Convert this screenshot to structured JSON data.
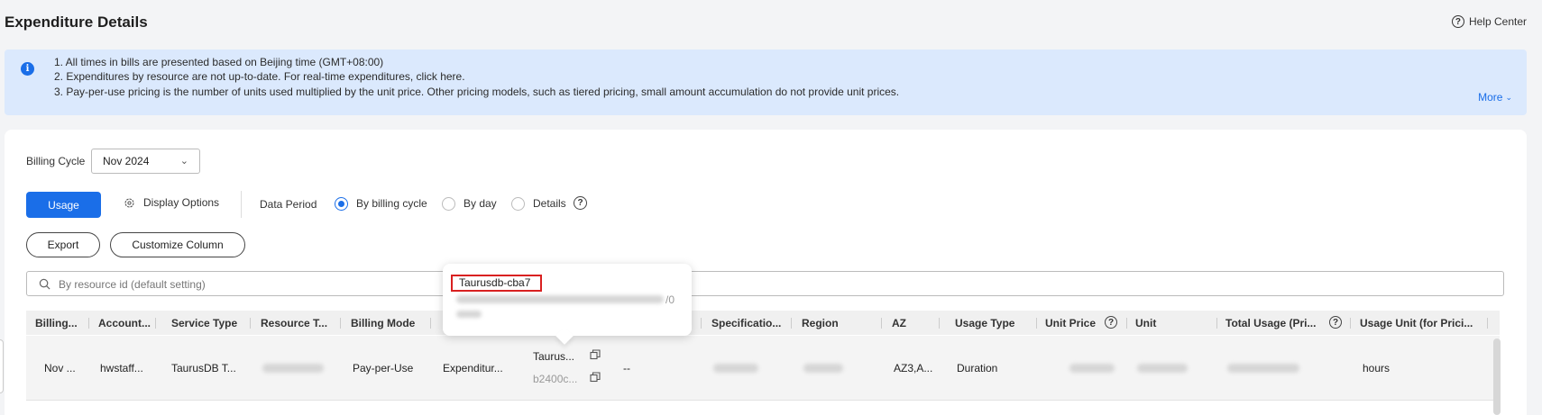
{
  "header": {
    "title": "Expenditure Details",
    "help_label": "Help Center"
  },
  "notice": {
    "lines": [
      "1. All times in bills are presented based on Beijing time (GMT+08:00)",
      "2. Expenditures by resource are not up-to-date. For real-time expenditures, click here.",
      "3. Pay-per-use pricing is the number of units used multiplied by the unit price. Other pricing models, such as tiered pricing, small amount accumulation do not provide unit prices."
    ],
    "more_label": "More"
  },
  "filters": {
    "billing_cycle_label": "Billing Cycle",
    "billing_cycle_value": "Nov 2024",
    "usage_label": "Usage",
    "display_options_label": "Display Options",
    "data_period_label": "Data Period",
    "period_options": [
      {
        "label": "By billing cycle",
        "checked": true
      },
      {
        "label": "By day",
        "checked": false
      },
      {
        "label": "Details",
        "checked": false
      }
    ]
  },
  "toolbar": {
    "export_label": "Export",
    "customize_label": "Customize Column"
  },
  "search": {
    "placeholder": "By resource id (default setting)"
  },
  "table": {
    "columns": [
      "Billing...",
      "Account...",
      "Service Type",
      "Resource T...",
      "Billing Mode",
      "",
      "",
      "",
      "Specificatio...",
      "Region",
      "AZ",
      "Usage Type",
      "Unit Price",
      "Unit",
      "Total Usage (Pri...",
      "Usage Unit (for Prici..."
    ],
    "row": {
      "billing_cycle": "Nov ...",
      "account": "hwstaff...",
      "service_type": "TaurusDB T...",
      "billing_mode": "Pay-per-Use",
      "expenditure_type": "Expenditur...",
      "resource_name": "Taurus...",
      "resource_id": "b2400c...",
      "tag": "--",
      "az": "AZ3,A...",
      "usage_type": "Duration",
      "usage_unit": "hours"
    }
  },
  "popover": {
    "resource_name": "Taurusdb-cba7",
    "tail_text": "/0"
  },
  "colors": {
    "accent": "#1a6ee8",
    "notice_bg": "#dbe9fd",
    "highlight": "#d92020"
  }
}
